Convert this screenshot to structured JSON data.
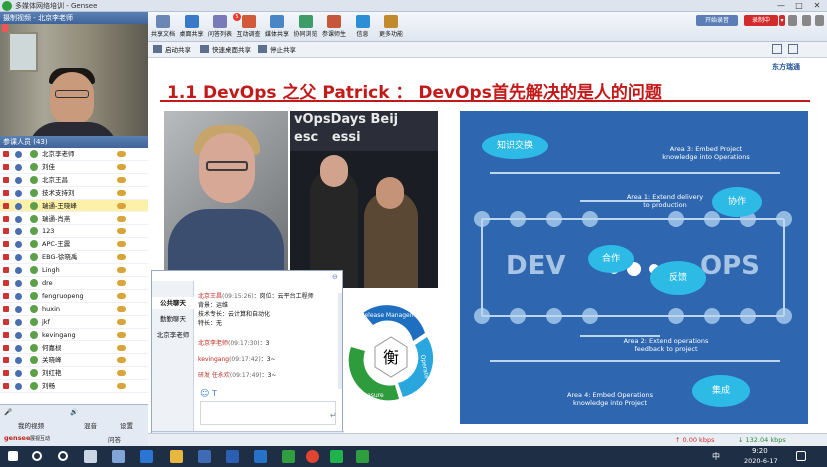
{
  "window": {
    "title": "多媒体网络培训 - Gensee",
    "minimize": "—",
    "maximize": "□",
    "close": "✕"
  },
  "video_panel": {
    "title": "摄制视频 - 北京李老师"
  },
  "participants": {
    "title": "参课人员 (43)",
    "items": [
      {
        "name": "北京李老师",
        "selected": false
      },
      {
        "name": "刘佳",
        "selected": false
      },
      {
        "name": "北京王昌",
        "selected": false
      },
      {
        "name": "技术支持刘",
        "selected": false
      },
      {
        "name": "瑞通-王晓峰",
        "selected": true
      },
      {
        "name": "瑞通-肖燕",
        "selected": false
      },
      {
        "name": "123",
        "selected": false
      },
      {
        "name": "APC-王震",
        "selected": false
      },
      {
        "name": "EBG-徐晓禹",
        "selected": false
      },
      {
        "name": "Lingh",
        "selected": false
      },
      {
        "name": "dre",
        "selected": false
      },
      {
        "name": "fengruopeng",
        "selected": false
      },
      {
        "name": "huxin",
        "selected": false
      },
      {
        "name": "jkf",
        "selected": false
      },
      {
        "name": "kevingang",
        "selected": false
      },
      {
        "name": "何嘉棂",
        "selected": false
      },
      {
        "name": "关晓峰",
        "selected": false
      },
      {
        "name": "刘红艳",
        "selected": false
      },
      {
        "name": "刘畅",
        "selected": false
      }
    ]
  },
  "left_bottom": {
    "my_video": "我的视频",
    "mixer": "混音",
    "settings": "设置",
    "qa": "问答",
    "brand": "gensee",
    "brand_sub": "展视互动"
  },
  "toolbar": {
    "tools": [
      "共享文档",
      "桌面共享",
      "问答列表",
      "互动调查",
      "媒体共享",
      "协同浏览",
      "参课师生",
      "信息",
      "更多功能"
    ],
    "badge": "5",
    "start_record": "开始录音",
    "recording": "录制中",
    "record_arrow": "▾"
  },
  "subtoolbar": {
    "start_share": "启动共享",
    "quick_share": "快速桌面共享",
    "stop_share": "停止共享"
  },
  "slide": {
    "title": "1.1 DevOps 之父 Patrick ： DevOps首先解决的是人的问题",
    "brand": "东方瑞通",
    "photo2_sign": "vOpsDays Beij\nesc   essi",
    "wheel": {
      "center": "衡",
      "release": "Release Management",
      "operate": "Operate",
      "measure": "Measure"
    },
    "diagram": {
      "area3": "Area 3: Embed Project\nknowledge into Operations",
      "area1": "Area 1: Extend delivery\nto production",
      "area2": "Area 2: Extend operations\nfeedback to project",
      "area4": "Area 4: Embed Operations\nknowledge into Project",
      "dev": "DEV",
      "ops": "OPS",
      "bubble_share": "知识交换",
      "bubble_collab": "协作",
      "bubble_coop": "合作",
      "bubble_feedback": "反馈",
      "bubble_integrate": "集成"
    }
  },
  "chat": {
    "tabs": [
      "公共聊天",
      "勤勤聊天",
      "北京李老师"
    ],
    "messages": [
      {
        "who": "北京王昌",
        "time": "(09:15:26)",
        "text": "：岗位：云平台工程师"
      },
      {
        "who": "",
        "time": "",
        "text": "背景：运维"
      },
      {
        "who": "",
        "time": "",
        "text": "技术专长：云计算和自动化"
      },
      {
        "who": "",
        "time": "",
        "text": "特长：无"
      },
      {
        "who": "北京李老师",
        "time": "(09:17:30)",
        "text": "：3"
      },
      {
        "who": "kevingang",
        "time": "(09:17:42)",
        "text": "：3~"
      },
      {
        "who": "研发 任永欢",
        "time": "(09:17:49)",
        "text": "：3~"
      }
    ],
    "footer": "聊天"
  },
  "statusbar": {
    "up": "↑ 0.00 kbps",
    "down": "↓ 132.04 kbps"
  },
  "taskbar": {
    "time": "9:20",
    "date": "2020-6-17",
    "ime": "中"
  }
}
